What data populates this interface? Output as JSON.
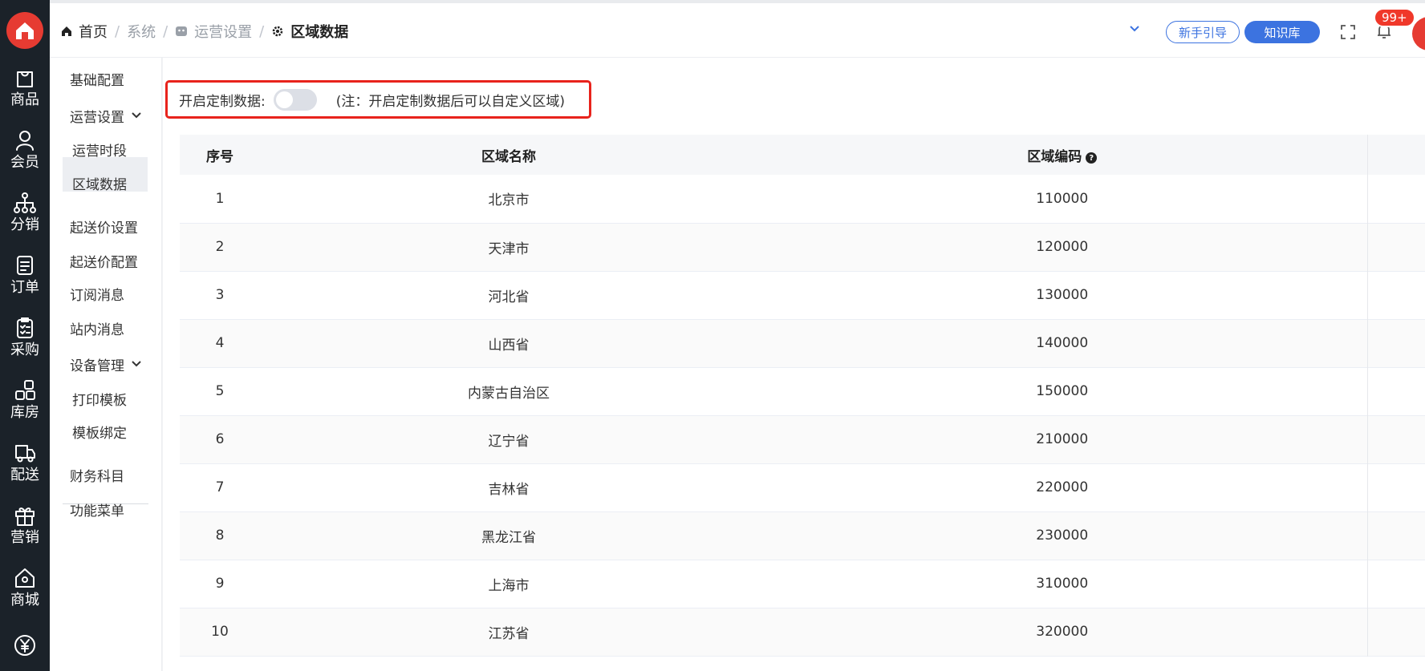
{
  "rail": {
    "items": [
      {
        "label": "商品",
        "icon": "bag-icon"
      },
      {
        "label": "会员",
        "icon": "user-icon"
      },
      {
        "label": "分销",
        "icon": "network-icon"
      },
      {
        "label": "订单",
        "icon": "document-icon"
      },
      {
        "label": "采购",
        "icon": "clipboard-icon"
      },
      {
        "label": "库房",
        "icon": "grid-icon"
      },
      {
        "label": "配送",
        "icon": "truck-icon"
      },
      {
        "label": "营销",
        "icon": "gift-icon"
      },
      {
        "label": "商城",
        "icon": "home-icon"
      },
      {
        "label": "",
        "icon": "yen-icon"
      }
    ]
  },
  "breadcrumb": {
    "home": "首页",
    "system": "系统",
    "ops": "运营设置",
    "current": "区域数据"
  },
  "header": {
    "guide_label": "新手引导",
    "kb_label": "知识库",
    "notif_count": "99+"
  },
  "submenu": {
    "basic": "基础配置",
    "ops_group": "运营设置",
    "ops_hours": "运营时段",
    "region_data": "区域数据",
    "min_price_setting": "起送价设置",
    "min_price_config": "起送价配置",
    "subscribe_msg": "订阅消息",
    "site_msg": "站内消息",
    "device_group": "设备管理",
    "print_tpl": "打印模板",
    "tpl_bind": "模板绑定",
    "finance": "财务科目",
    "func_menu": "功能菜单"
  },
  "toggle": {
    "label": "开启定制数据:",
    "note": "(注：开启定制数据后可以自定义区域)"
  },
  "table": {
    "headers": {
      "no": "序号",
      "name": "区域名称",
      "code": "区域编码"
    },
    "rows": [
      {
        "no": "1",
        "name": "北京市",
        "code": "110000"
      },
      {
        "no": "2",
        "name": "天津市",
        "code": "120000"
      },
      {
        "no": "3",
        "name": "河北省",
        "code": "130000"
      },
      {
        "no": "4",
        "name": "山西省",
        "code": "140000"
      },
      {
        "no": "5",
        "name": "内蒙古自治区",
        "code": "150000"
      },
      {
        "no": "6",
        "name": "辽宁省",
        "code": "210000"
      },
      {
        "no": "7",
        "name": "吉林省",
        "code": "220000"
      },
      {
        "no": "8",
        "name": "黑龙江省",
        "code": "230000"
      },
      {
        "no": "9",
        "name": "上海市",
        "code": "310000"
      },
      {
        "no": "10",
        "name": "江苏省",
        "code": "320000"
      }
    ]
  },
  "colors": {
    "accent": "#3c73e0",
    "danger": "#e8231c",
    "rail": "#1b2229"
  }
}
